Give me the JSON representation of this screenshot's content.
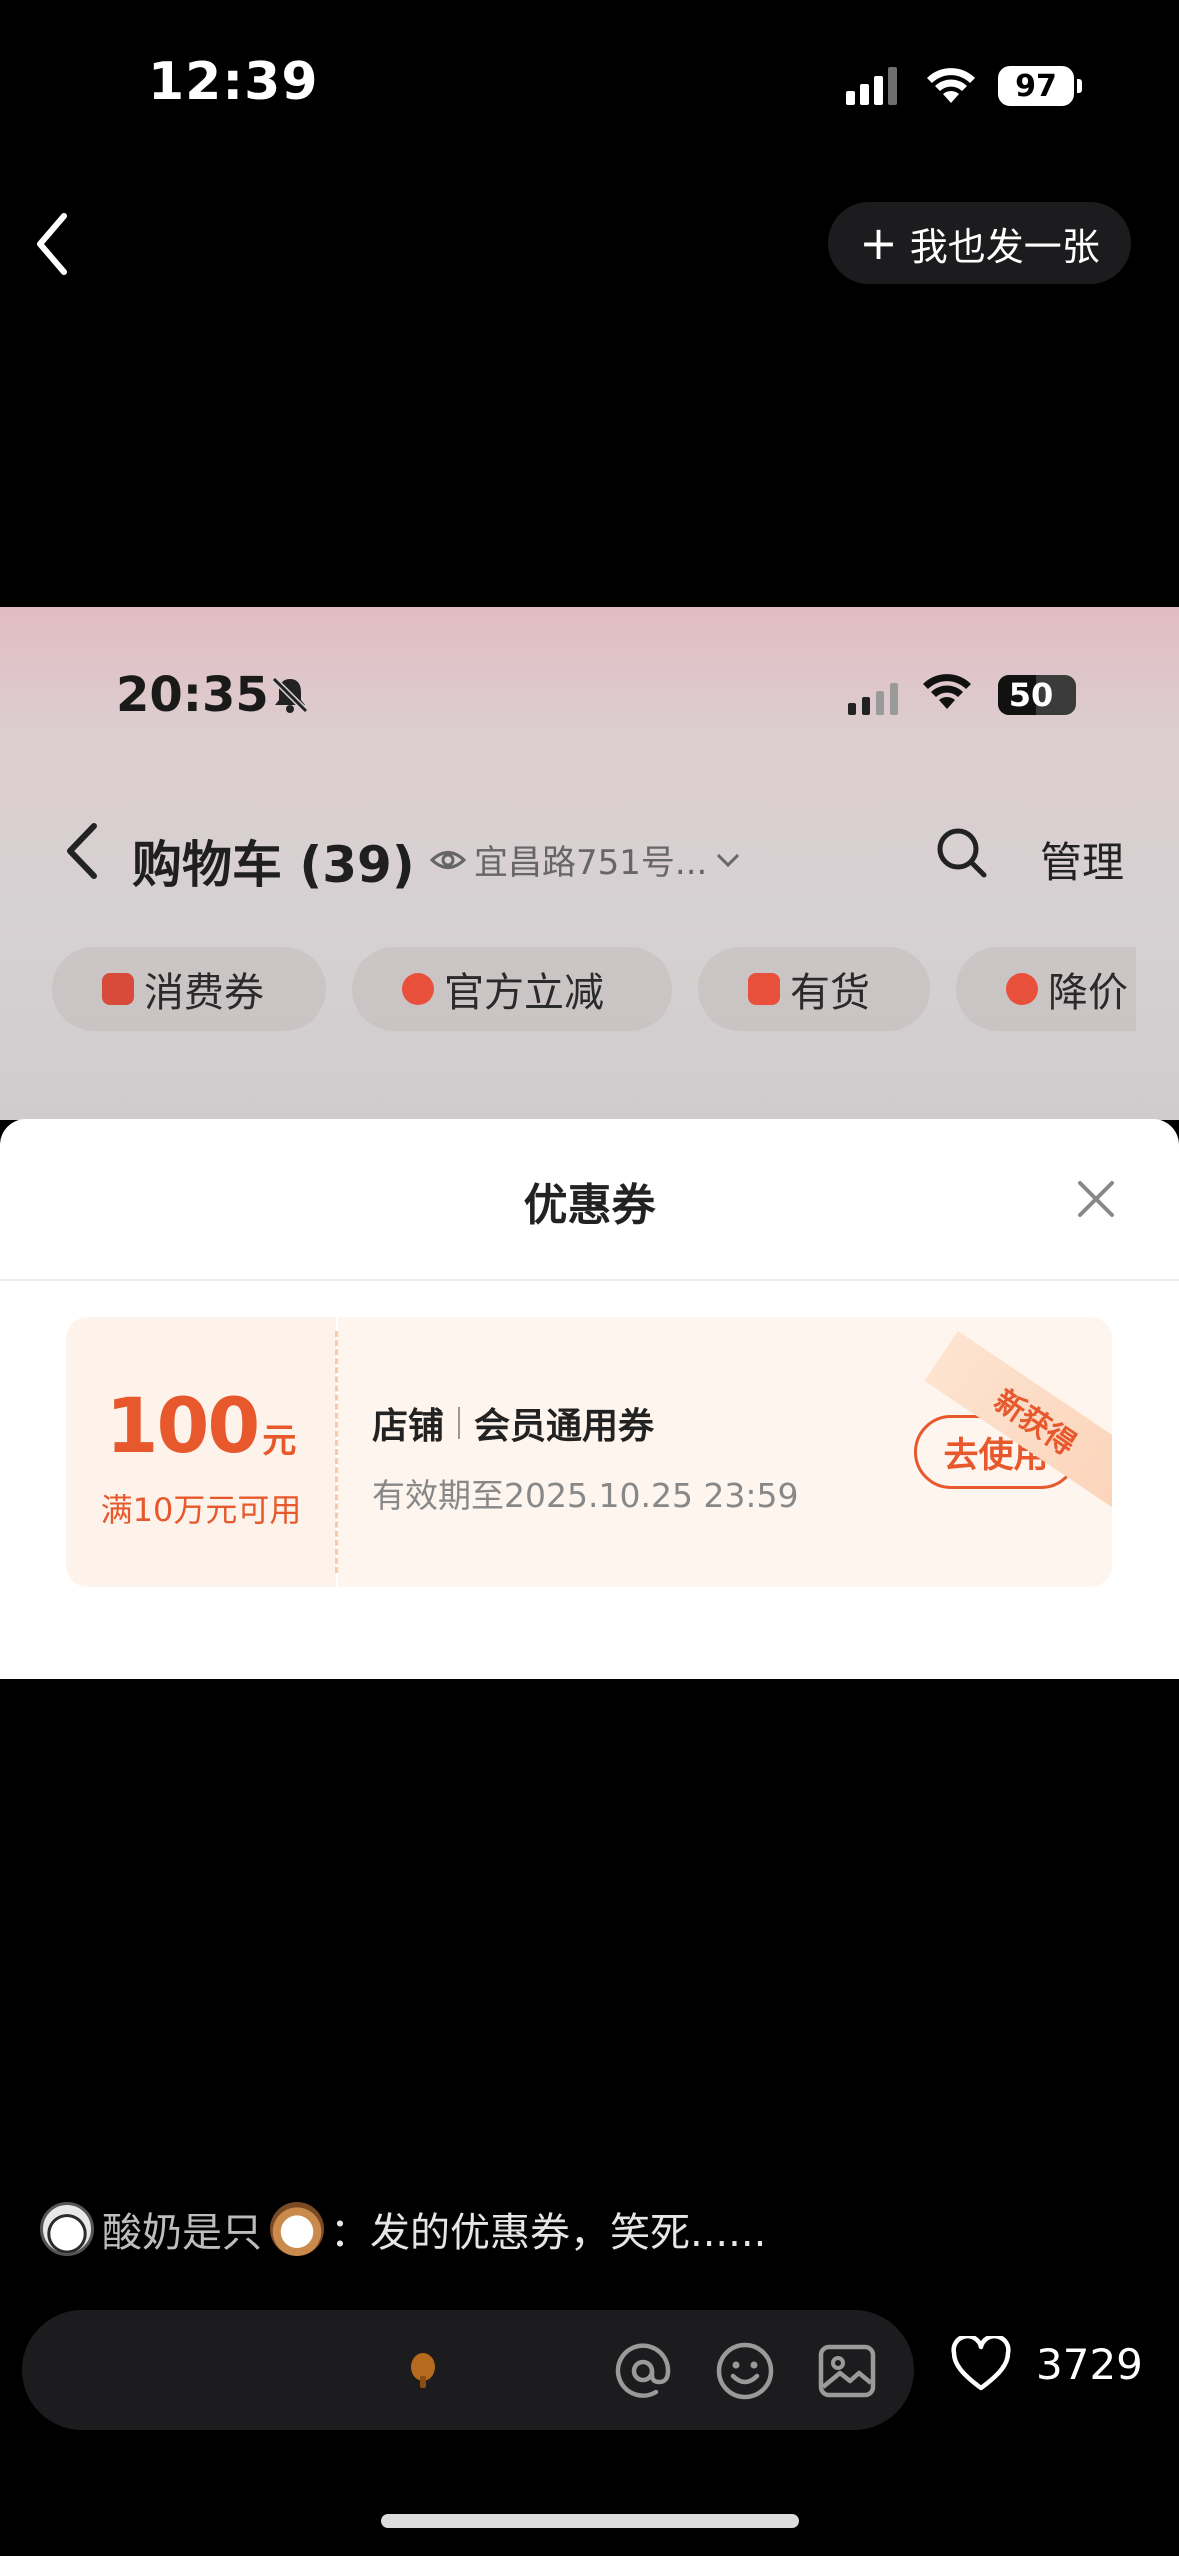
{
  "status_bar": {
    "time": "12:39",
    "battery": "97"
  },
  "header": {
    "post_button_label": "我也发一张"
  },
  "screenshot": {
    "status_bar": {
      "time": "20:35",
      "battery": "50"
    },
    "nav": {
      "title": "购物车 (39)",
      "address": "宜昌路751号...",
      "manage_label": "管理"
    },
    "filter_chips": [
      {
        "label": "消费券",
        "icon": "ticket-icon",
        "color": "#d84a3a"
      },
      {
        "label": "官方立减",
        "icon": "lightning-icon",
        "color": "#e8503c"
      },
      {
        "label": "有货",
        "icon": "cart-icon",
        "color": "#e8503c"
      },
      {
        "label": "降价",
        "icon": "price-down-icon",
        "color": "#e8503c"
      }
    ],
    "coupon_sheet": {
      "title": "优惠券",
      "coupon": {
        "amount": "100",
        "unit": "元",
        "condition": "满10万元可用",
        "shop": "店铺",
        "name": "会员通用券",
        "expiry": "有效期至2025.10.25 23:59",
        "use_button": "去使用",
        "tag": "新获得"
      }
    }
  },
  "comment": {
    "username": "酸奶是只",
    "text": "：发的优惠券，笑死......"
  },
  "bottom_bar": {
    "like_count": "3729"
  },
  "colors": {
    "accent": "#e7582c",
    "background": "#000000"
  }
}
